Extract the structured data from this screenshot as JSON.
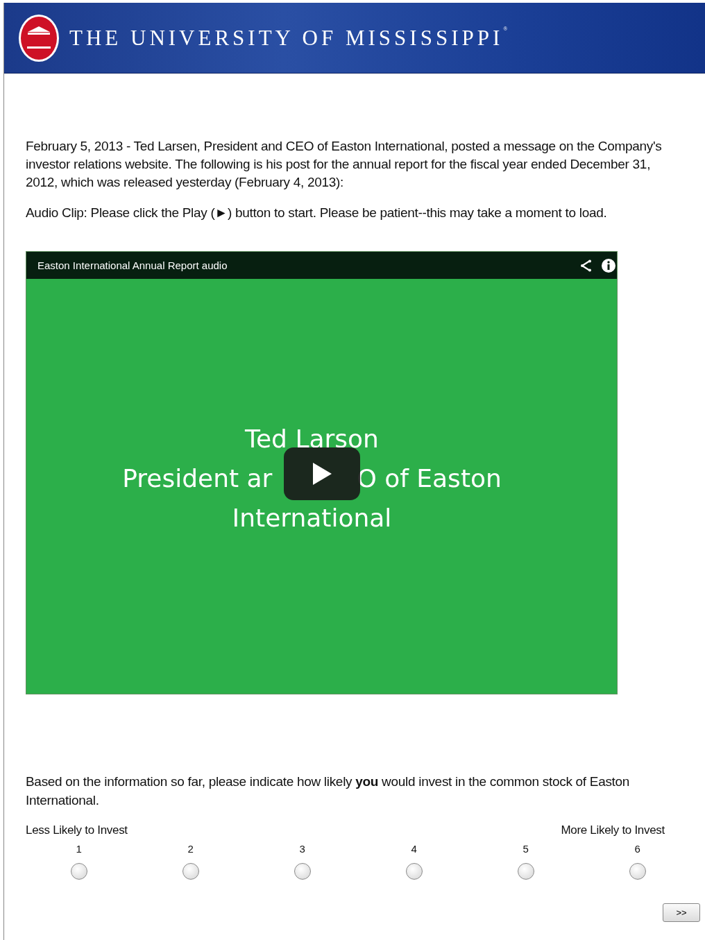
{
  "header": {
    "title": "THE UNIVERSITY OF MISSISSIPPI$^{®}$"
  },
  "intro": "February 5, 2013 - Ted Larsen, President and CEO of Easton International, posted a message on the Company's investor relations website.  The following is his post for the annual report for the fiscal year ended December 31, 2012, which was released yesterday (February 4, 2013):",
  "instruction": "Audio Clip:  Please click the Play (►) button to start.  Please be patient--this may take a moment to load.",
  "player": {
    "title": "Easton International Annual Report audio",
    "slide_lines": [
      [
        "Ted Larson"
      ],
      [
        "President ar",
        "O of Easton"
      ],
      [
        "International"
      ]
    ]
  },
  "question": "Based on the information so far, please indicate how likely **you** would invest in the common stock of Easton International.",
  "scale": {
    "low_label": "Less Likely to Invest",
    "high_label": "More Likely to Invest",
    "options": [
      {
        "label": "1",
        "selected": false
      },
      {
        "label": "2",
        "selected": false
      },
      {
        "label": "3",
        "selected": false
      },
      {
        "label": "4",
        "selected": false
      },
      {
        "label": "5",
        "selected": false
      },
      {
        "label": "6",
        "selected": false
      }
    ]
  },
  "next_button": ">>"
}
